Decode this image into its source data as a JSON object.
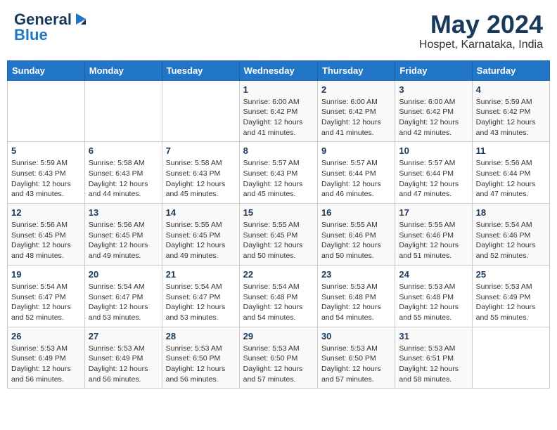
{
  "logo": {
    "general": "General",
    "blue": "Blue"
  },
  "title": {
    "month_year": "May 2024",
    "location": "Hospet, Karnataka, India"
  },
  "weekdays": [
    "Sunday",
    "Monday",
    "Tuesday",
    "Wednesday",
    "Thursday",
    "Friday",
    "Saturday"
  ],
  "weeks": [
    [
      {
        "day": "",
        "info": ""
      },
      {
        "day": "",
        "info": ""
      },
      {
        "day": "",
        "info": ""
      },
      {
        "day": "1",
        "info": "Sunrise: 6:00 AM\nSunset: 6:42 PM\nDaylight: 12 hours\nand 41 minutes."
      },
      {
        "day": "2",
        "info": "Sunrise: 6:00 AM\nSunset: 6:42 PM\nDaylight: 12 hours\nand 41 minutes."
      },
      {
        "day": "3",
        "info": "Sunrise: 6:00 AM\nSunset: 6:42 PM\nDaylight: 12 hours\nand 42 minutes."
      },
      {
        "day": "4",
        "info": "Sunrise: 5:59 AM\nSunset: 6:42 PM\nDaylight: 12 hours\nand 43 minutes."
      }
    ],
    [
      {
        "day": "5",
        "info": "Sunrise: 5:59 AM\nSunset: 6:43 PM\nDaylight: 12 hours\nand 43 minutes."
      },
      {
        "day": "6",
        "info": "Sunrise: 5:58 AM\nSunset: 6:43 PM\nDaylight: 12 hours\nand 44 minutes."
      },
      {
        "day": "7",
        "info": "Sunrise: 5:58 AM\nSunset: 6:43 PM\nDaylight: 12 hours\nand 45 minutes."
      },
      {
        "day": "8",
        "info": "Sunrise: 5:57 AM\nSunset: 6:43 PM\nDaylight: 12 hours\nand 45 minutes."
      },
      {
        "day": "9",
        "info": "Sunrise: 5:57 AM\nSunset: 6:44 PM\nDaylight: 12 hours\nand 46 minutes."
      },
      {
        "day": "10",
        "info": "Sunrise: 5:57 AM\nSunset: 6:44 PM\nDaylight: 12 hours\nand 47 minutes."
      },
      {
        "day": "11",
        "info": "Sunrise: 5:56 AM\nSunset: 6:44 PM\nDaylight: 12 hours\nand 47 minutes."
      }
    ],
    [
      {
        "day": "12",
        "info": "Sunrise: 5:56 AM\nSunset: 6:45 PM\nDaylight: 12 hours\nand 48 minutes."
      },
      {
        "day": "13",
        "info": "Sunrise: 5:56 AM\nSunset: 6:45 PM\nDaylight: 12 hours\nand 49 minutes."
      },
      {
        "day": "14",
        "info": "Sunrise: 5:55 AM\nSunset: 6:45 PM\nDaylight: 12 hours\nand 49 minutes."
      },
      {
        "day": "15",
        "info": "Sunrise: 5:55 AM\nSunset: 6:45 PM\nDaylight: 12 hours\nand 50 minutes."
      },
      {
        "day": "16",
        "info": "Sunrise: 5:55 AM\nSunset: 6:46 PM\nDaylight: 12 hours\nand 50 minutes."
      },
      {
        "day": "17",
        "info": "Sunrise: 5:55 AM\nSunset: 6:46 PM\nDaylight: 12 hours\nand 51 minutes."
      },
      {
        "day": "18",
        "info": "Sunrise: 5:54 AM\nSunset: 6:46 PM\nDaylight: 12 hours\nand 52 minutes."
      }
    ],
    [
      {
        "day": "19",
        "info": "Sunrise: 5:54 AM\nSunset: 6:47 PM\nDaylight: 12 hours\nand 52 minutes."
      },
      {
        "day": "20",
        "info": "Sunrise: 5:54 AM\nSunset: 6:47 PM\nDaylight: 12 hours\nand 53 minutes."
      },
      {
        "day": "21",
        "info": "Sunrise: 5:54 AM\nSunset: 6:47 PM\nDaylight: 12 hours\nand 53 minutes."
      },
      {
        "day": "22",
        "info": "Sunrise: 5:54 AM\nSunset: 6:48 PM\nDaylight: 12 hours\nand 54 minutes."
      },
      {
        "day": "23",
        "info": "Sunrise: 5:53 AM\nSunset: 6:48 PM\nDaylight: 12 hours\nand 54 minutes."
      },
      {
        "day": "24",
        "info": "Sunrise: 5:53 AM\nSunset: 6:48 PM\nDaylight: 12 hours\nand 55 minutes."
      },
      {
        "day": "25",
        "info": "Sunrise: 5:53 AM\nSunset: 6:49 PM\nDaylight: 12 hours\nand 55 minutes."
      }
    ],
    [
      {
        "day": "26",
        "info": "Sunrise: 5:53 AM\nSunset: 6:49 PM\nDaylight: 12 hours\nand 56 minutes."
      },
      {
        "day": "27",
        "info": "Sunrise: 5:53 AM\nSunset: 6:49 PM\nDaylight: 12 hours\nand 56 minutes."
      },
      {
        "day": "28",
        "info": "Sunrise: 5:53 AM\nSunset: 6:50 PM\nDaylight: 12 hours\nand 56 minutes."
      },
      {
        "day": "29",
        "info": "Sunrise: 5:53 AM\nSunset: 6:50 PM\nDaylight: 12 hours\nand 57 minutes."
      },
      {
        "day": "30",
        "info": "Sunrise: 5:53 AM\nSunset: 6:50 PM\nDaylight: 12 hours\nand 57 minutes."
      },
      {
        "day": "31",
        "info": "Sunrise: 5:53 AM\nSunset: 6:51 PM\nDaylight: 12 hours\nand 58 minutes."
      },
      {
        "day": "",
        "info": ""
      }
    ]
  ]
}
